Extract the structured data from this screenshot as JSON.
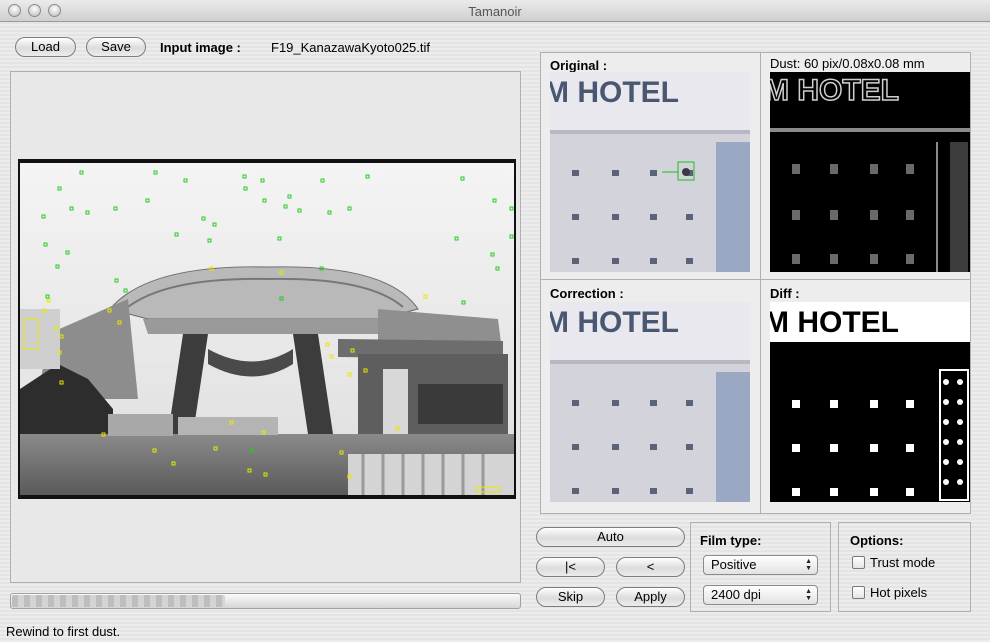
{
  "window": {
    "title": "Tamanoir"
  },
  "toolbar": {
    "load_label": "Load",
    "save_label": "Save",
    "input_image_label": "Input image :",
    "filename": "F19_KanazawaKyoto025.tif"
  },
  "preview": {
    "original_label": "Original :",
    "dust_info": "Dust: 60 pix/0.08x0.08 mm",
    "correction_label": "Correction :",
    "diff_label": "Diff :",
    "hotel_text": "M HOTEL"
  },
  "controls": {
    "auto_label": "Auto",
    "first_label": "|<",
    "prev_label": "<",
    "skip_label": "Skip",
    "apply_label": "Apply"
  },
  "film": {
    "title": "Film type:",
    "type_value": "Positive",
    "dpi_value": "2400 dpi"
  },
  "options": {
    "title": "Options:",
    "trust_mode_label": "Trust mode",
    "trust_mode_checked": false,
    "hot_pixels_label": "Hot pixels",
    "hot_pixels_checked": false
  },
  "progress": {
    "fraction": 0.42
  },
  "status": {
    "text": "Rewind to first dust."
  },
  "colors": {
    "dust_green": "#22cc22",
    "dust_yellow": "#e8e800"
  },
  "icons": {
    "close": "traffic-light",
    "minimize": "traffic-light",
    "zoom": "traffic-light"
  }
}
